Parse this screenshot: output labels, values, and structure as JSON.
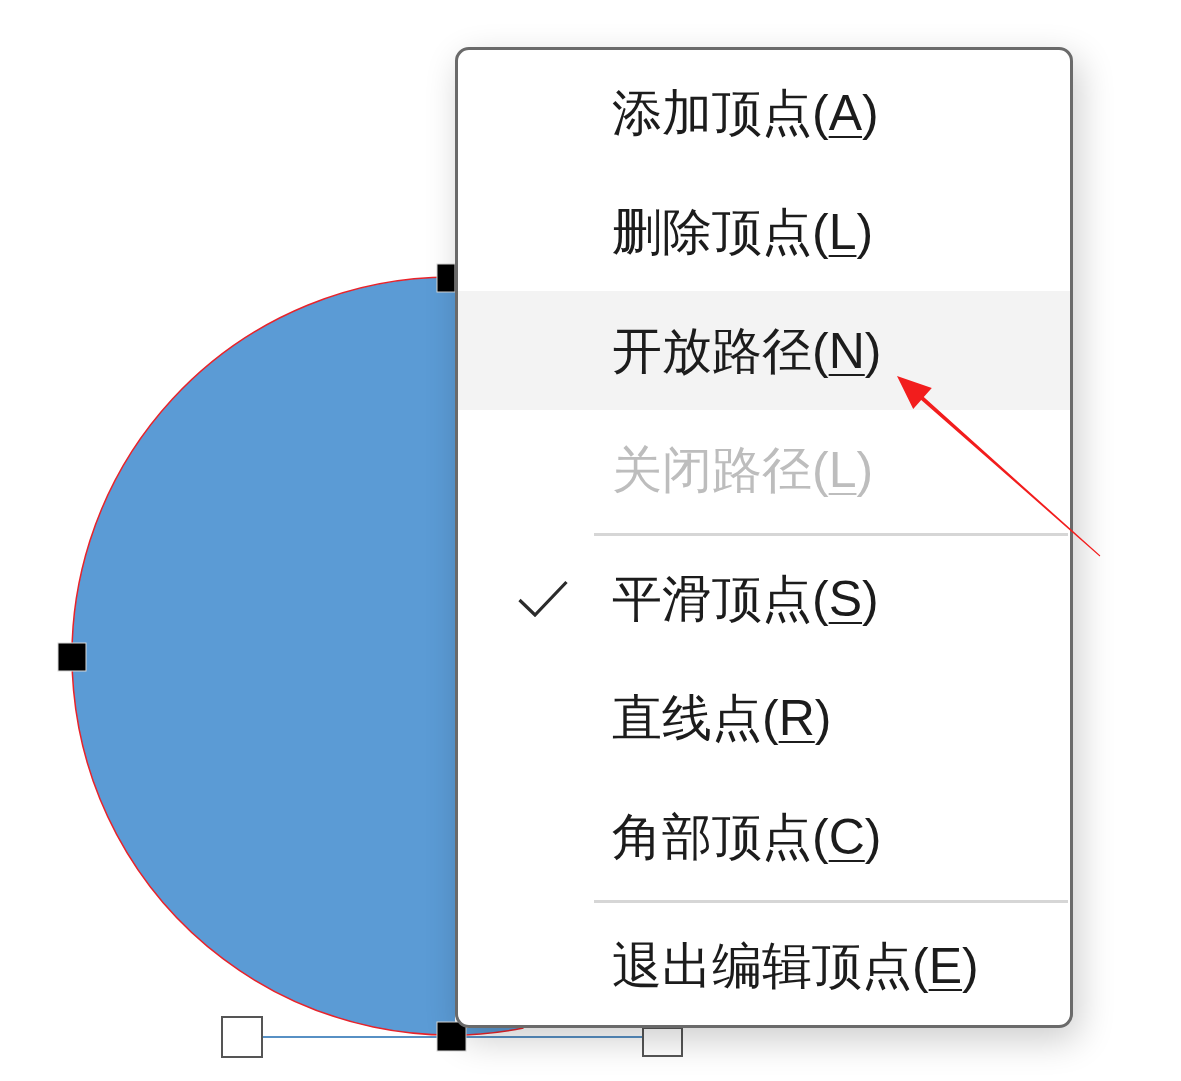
{
  "menu": {
    "items": [
      {
        "kind": "item",
        "label_start": "添加顶点(",
        "access_key": "A",
        "label_end": ")",
        "selected": false,
        "disabled": false,
        "checked": false
      },
      {
        "kind": "item",
        "label_start": "删除顶点(",
        "access_key": "L",
        "label_end": ")",
        "selected": false,
        "disabled": false,
        "checked": false
      },
      {
        "kind": "item",
        "label_start": "开放路径(",
        "access_key": "N",
        "label_end": ")",
        "selected": true,
        "disabled": false,
        "checked": false
      },
      {
        "kind": "item",
        "label_start": "关闭路径(",
        "access_key": "L",
        "label_end": ")",
        "selected": false,
        "disabled": true,
        "checked": false
      },
      {
        "kind": "separator"
      },
      {
        "kind": "item",
        "label_start": "平滑顶点(",
        "access_key": "S",
        "label_end": ")",
        "selected": false,
        "disabled": false,
        "checked": true
      },
      {
        "kind": "item",
        "label_start": "直线点(",
        "access_key": "R",
        "label_end": ")",
        "selected": false,
        "disabled": false,
        "checked": false
      },
      {
        "kind": "item",
        "label_start": "角部顶点(",
        "access_key": "C",
        "label_end": ")",
        "selected": false,
        "disabled": false,
        "checked": false
      },
      {
        "kind": "separator"
      },
      {
        "kind": "item",
        "label_start": "退出编辑顶点(",
        "access_key": "E",
        "label_end": ")",
        "selected": false,
        "disabled": false,
        "checked": false
      }
    ]
  }
}
